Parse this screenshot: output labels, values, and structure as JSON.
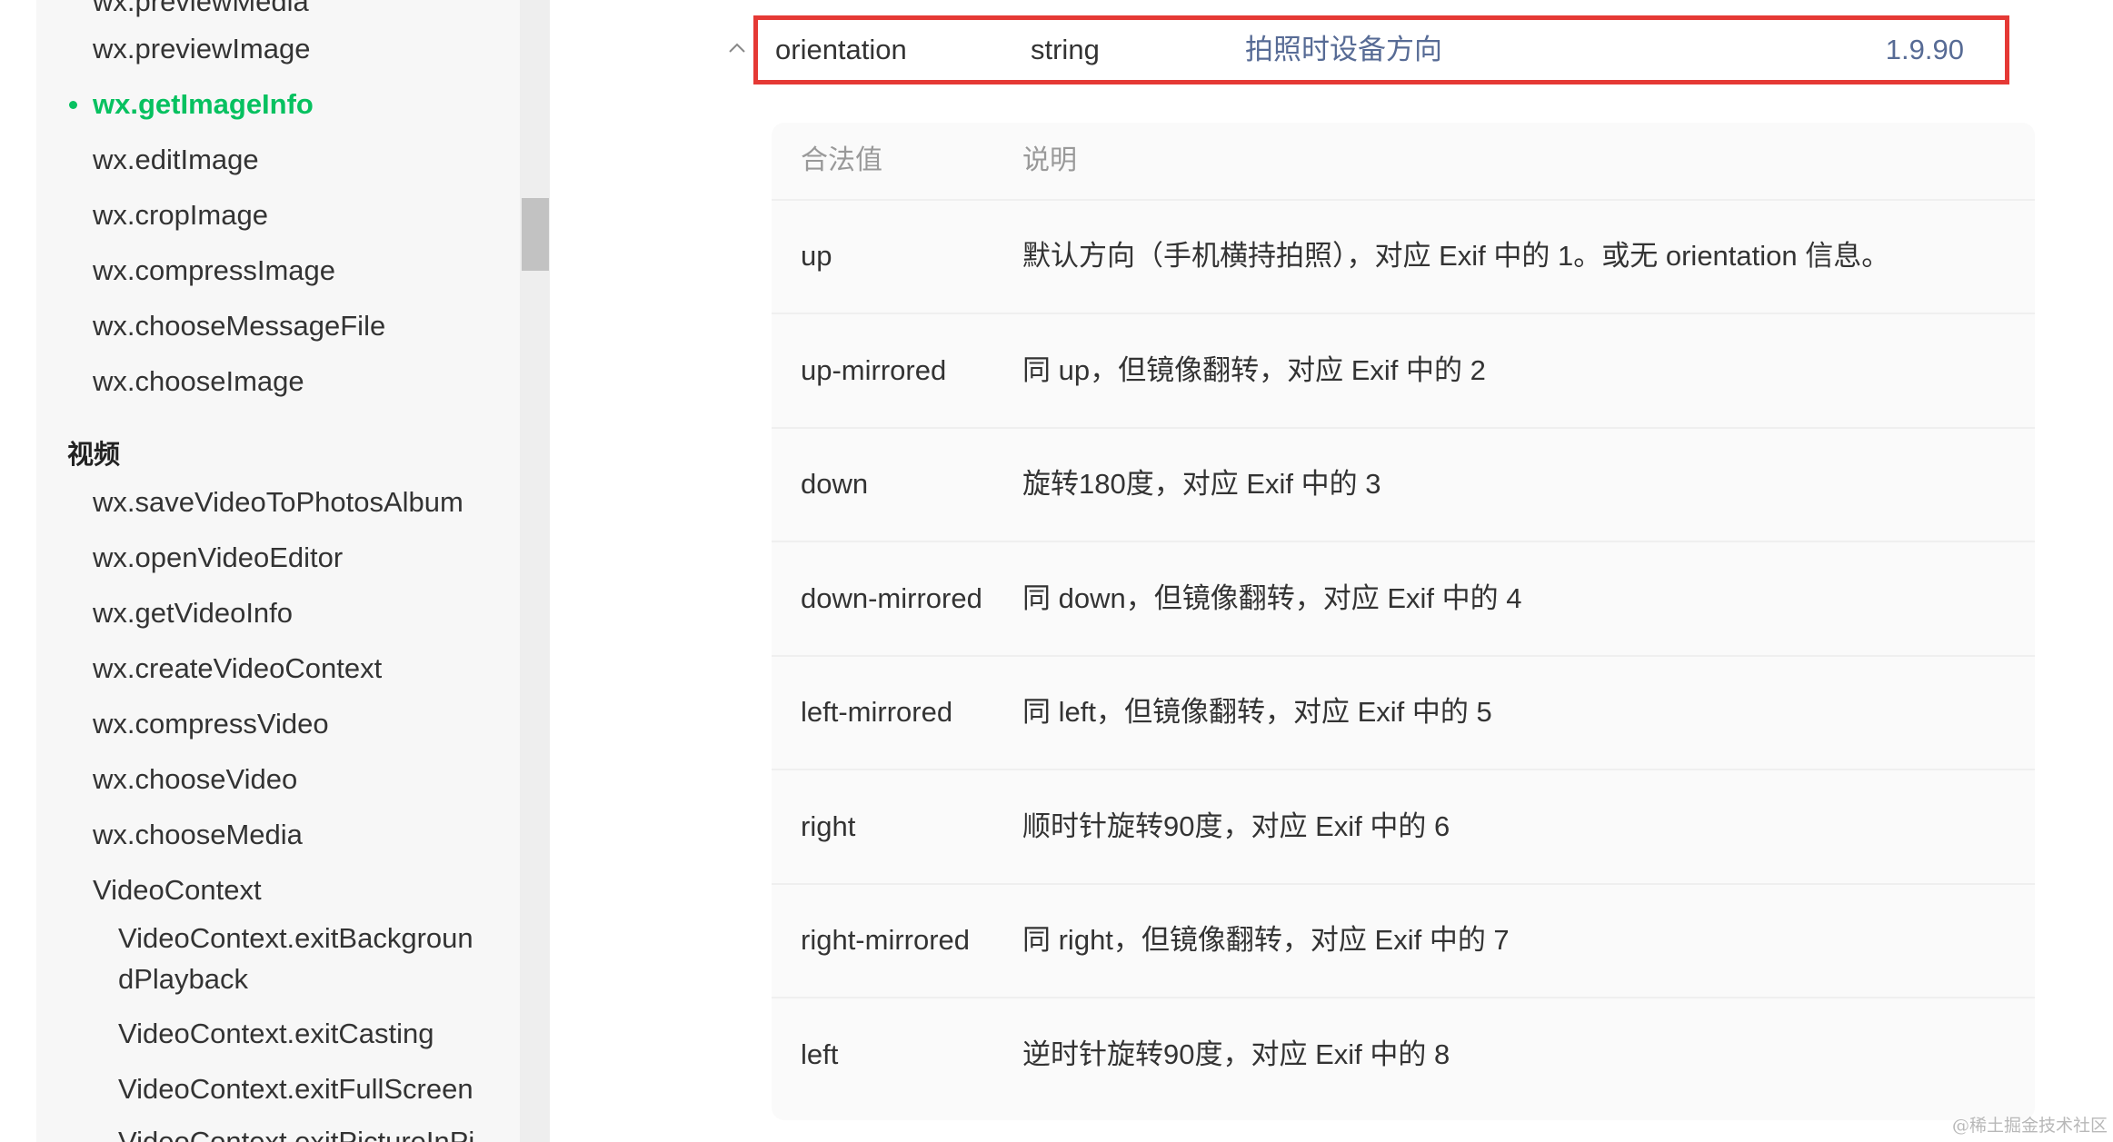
{
  "sidebar": {
    "items_top": [
      {
        "label": "wx.previewMedia"
      },
      {
        "label": "wx.previewImage"
      },
      {
        "label": "wx.getImageInfo",
        "active": true
      },
      {
        "label": "wx.editImage"
      },
      {
        "label": "wx.cropImage"
      },
      {
        "label": "wx.compressImage"
      },
      {
        "label": "wx.chooseMessageFile"
      },
      {
        "label": "wx.chooseImage"
      }
    ],
    "video_heading": "视频",
    "video_items": [
      {
        "label": "wx.saveVideoToPhotosAlbum"
      },
      {
        "label": "wx.openVideoEditor"
      },
      {
        "label": "wx.getVideoInfo"
      },
      {
        "label": "wx.createVideoContext"
      },
      {
        "label": "wx.compressVideo"
      },
      {
        "label": "wx.chooseVideo"
      },
      {
        "label": "wx.chooseMedia"
      },
      {
        "label": "VideoContext"
      }
    ],
    "videocontext_items": [
      {
        "label": "VideoContext.exitBackgroun"
      },
      {
        "label": "dPlayback"
      },
      {
        "label": "VideoContext.exitCasting"
      },
      {
        "label": "VideoContext.exitFullScreen"
      },
      {
        "label": "VideoContext.exitPictureInPi"
      }
    ],
    "active_color": "#07c160"
  },
  "param": {
    "name": "orientation",
    "type": "string",
    "description": "拍照时设备方向",
    "version": "1.9.90",
    "highlight_color": "#e53935"
  },
  "values_table": {
    "headers": {
      "value": "合法值",
      "description": "说明"
    },
    "rows": [
      {
        "value": "up",
        "description": "默认方向（手机横持拍照），对应 Exif 中的 1。或无 orientation 信息。"
      },
      {
        "value": "up-mirrored",
        "description": "同 up，但镜像翻转，对应 Exif 中的 2"
      },
      {
        "value": "down",
        "description": "旋转180度，对应 Exif 中的 3"
      },
      {
        "value": "down-mirrored",
        "description": "同 down，但镜像翻转，对应 Exif 中的 4"
      },
      {
        "value": "left-mirrored",
        "description": "同 left，但镜像翻转，对应 Exif 中的 5"
      },
      {
        "value": "right",
        "description": "顺时针旋转90度，对应 Exif 中的 6"
      },
      {
        "value": "right-mirrored",
        "description": "同 right，但镜像翻转，对应 Exif 中的 7"
      },
      {
        "value": "left",
        "description": "逆时针旋转90度，对应 Exif 中的 8"
      }
    ]
  },
  "watermark": "@稀土掘金技术社区"
}
